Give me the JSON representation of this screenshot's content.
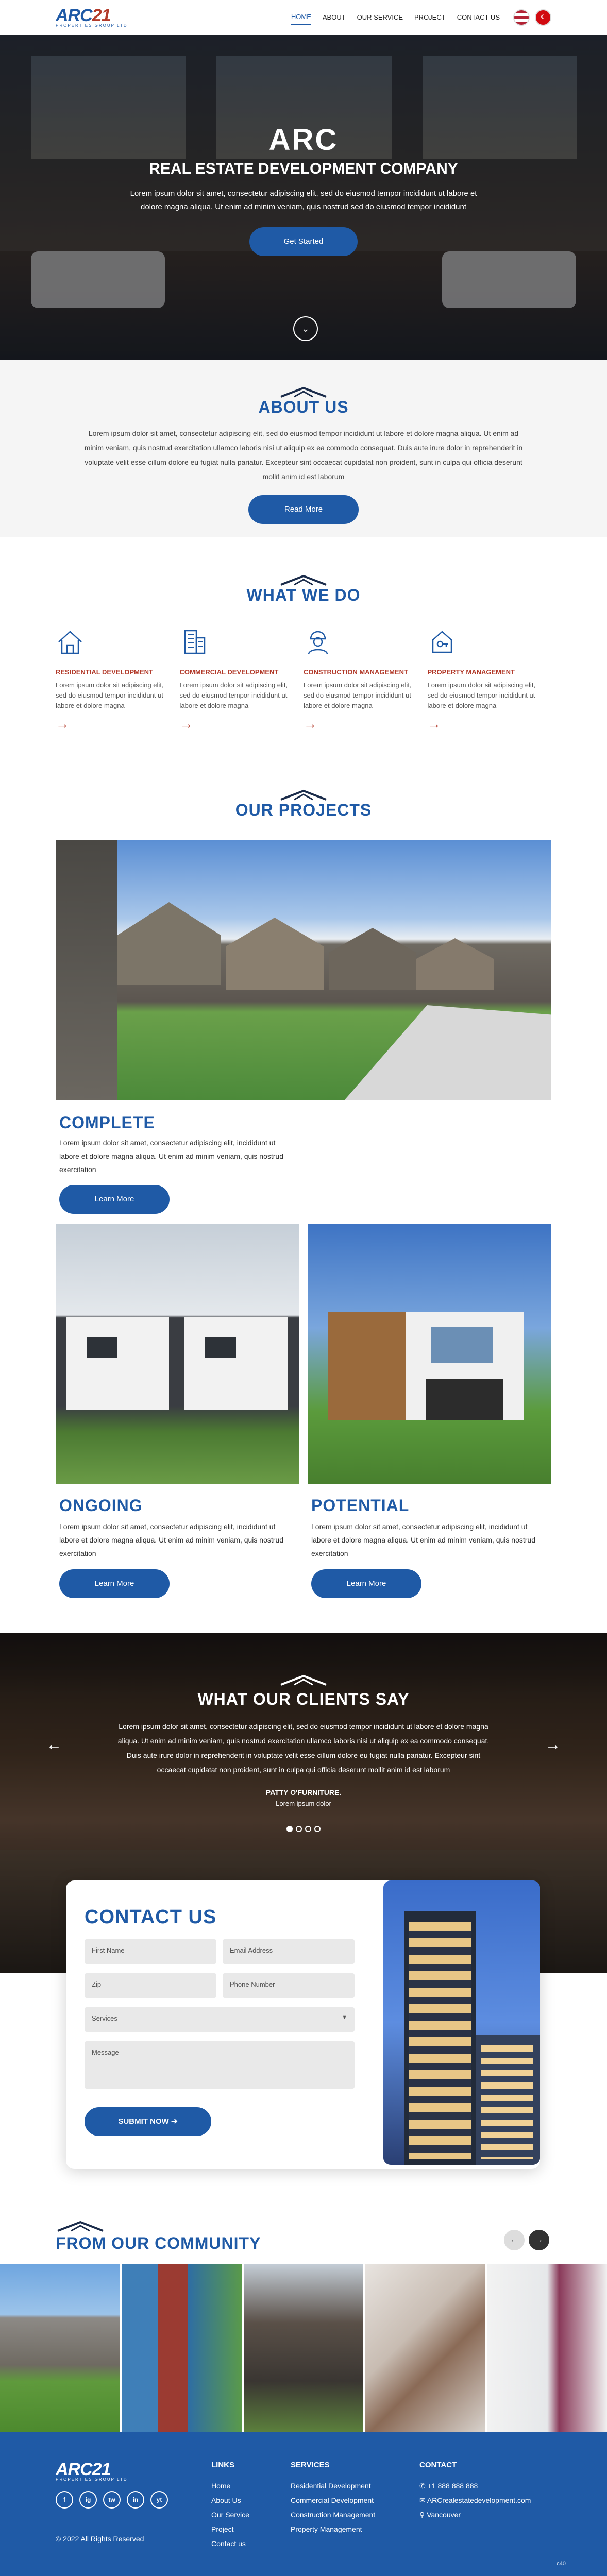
{
  "brand": {
    "name_main": "ARC",
    "name_accent": "21",
    "tagline": "PROPERTIES GROUP LTD"
  },
  "nav": {
    "items": [
      "HOME",
      "ABOUT",
      "OUR SERVICE",
      "PROJECT",
      "CONTACT US"
    ],
    "active": "HOME"
  },
  "flags": {
    "us": "US",
    "tr": "TR"
  },
  "hero": {
    "title": "ARC",
    "subtitle": "REAL ESTATE DEVELOPMENT COMPANY",
    "text": "Lorem ipsum dolor sit amet, consectetur adipiscing elit, sed do eiusmod tempor incididunt ut labore et dolore magna aliqua. Ut enim ad minim veniam, quis nostrud sed do eiusmod tempor incididunt",
    "cta": "Get Started",
    "scroll_icon": "chevron-down-icon"
  },
  "about": {
    "title": "ABOUT US",
    "text": "Lorem ipsum dolor sit amet, consectetur adipiscing elit, sed do eiusmod tempor incididunt ut labore et dolore magna aliqua. Ut enim ad minim veniam, quis nostrud exercitation ullamco laboris nisi ut aliquip ex ea commodo consequat. Duis aute irure dolor in reprehenderit in voluptate velit esse cillum dolore eu fugiat nulla pariatur. Excepteur sint occaecat cupidatat non proident, sunt in culpa qui officia deserunt mollit anim id est laborum",
    "cta": "Read More"
  },
  "what_we_do": {
    "title": "WHAT WE DO",
    "items": [
      {
        "title": "RESIDENTIAL DEVELOPMENT",
        "text": "Lorem ipsum dolor sit adipiscing elit, sed do eiusmod tempor incididunt ut labore et dolore magna",
        "icon": "house-icon"
      },
      {
        "title": "COMMERCIAL DEVELOPMENT",
        "text": "Lorem ipsum dolor sit adipiscing elit, sed do eiusmod tempor incididunt ut labore et dolore magna",
        "icon": "building-icon"
      },
      {
        "title": "CONSTRUCTION MANAGEMENT",
        "text": "Lorem ipsum dolor sit adipiscing elit, sed do eiusmod tempor incididunt ut labore et dolore magna",
        "icon": "worker-icon"
      },
      {
        "title": "PROPERTY MANAGEMENT",
        "text": "Lorem ipsum dolor sit adipiscing elit, sed do eiusmod tempor incididunt ut labore et dolore magna",
        "icon": "key-house-icon"
      }
    ]
  },
  "projects": {
    "title": "OUR PROJECTS",
    "items": [
      {
        "title": "COMPLETE",
        "text": "Lorem ipsum dolor sit amet, consectetur adipiscing elit, incididunt ut labore et dolore magna aliqua. Ut enim ad minim veniam, quis nostrud exercitation",
        "cta": "Learn More"
      },
      {
        "title": "ONGOING",
        "text": "Lorem ipsum dolor sit amet, consectetur adipiscing elit, incididunt ut labore et dolore magna aliqua. Ut enim ad minim veniam, quis nostrud exercitation",
        "cta": "Learn More"
      },
      {
        "title": "POTENTIAL",
        "text": "Lorem ipsum dolor sit amet, consectetur adipiscing elit, incididunt ut labore et dolore magna aliqua. Ut enim ad minim veniam, quis nostrud exercitation",
        "cta": "Learn More"
      }
    ]
  },
  "testimonials": {
    "title": "WHAT OUR CLIENTS SAY",
    "text": "Lorem ipsum dolor sit amet, consectetur adipiscing elit, sed do eiusmod tempor incididunt ut labore et dolore magna aliqua. Ut enim ad minim veniam, quis nostrud exercitation ullamco laboris nisi ut aliquip ex ea commodo consequat. Duis aute irure dolor in reprehenderit in voluptate velit esse cillum dolore eu fugiat nulla pariatur. Excepteur sint occaecat cupidatat non proident, sunt in culpa qui officia deserunt mollit anim id est laborum",
    "name": "PATTY O'FURNITURE.",
    "role": "Lorem ipsum dolor",
    "prev_icon": "arrow-left-icon",
    "next_icon": "arrow-right-icon"
  },
  "contact": {
    "title": "CONTACT US",
    "first_name": "First Name",
    "email": "Email Address",
    "zip": "Zip",
    "phone": "Phone Number",
    "services": "Services",
    "message": "Message",
    "submit": "SUBMIT NOW"
  },
  "community": {
    "title": "FROM OUR COMMUNITY"
  },
  "footer": {
    "links_title": "LINKS",
    "links": [
      "Home",
      "About Us",
      "Our Service",
      "Project",
      "Contact us"
    ],
    "services_title": "SERVICES",
    "services": [
      "Residential Development",
      "Commercial Development",
      "Construction Management",
      "Property Management"
    ],
    "contact_title": "CONTACT",
    "phone": "+1 888 888 888",
    "email": "ARCrealestatedevelopment.com",
    "location": "Vancouver",
    "copyright": "© 2022 All Rights Reserved",
    "social": [
      "f",
      "ig",
      "tw",
      "in",
      "yt"
    ],
    "badge": "c40"
  },
  "colors": {
    "primary": "#1f5aa6",
    "accent": "#b23a2a"
  }
}
